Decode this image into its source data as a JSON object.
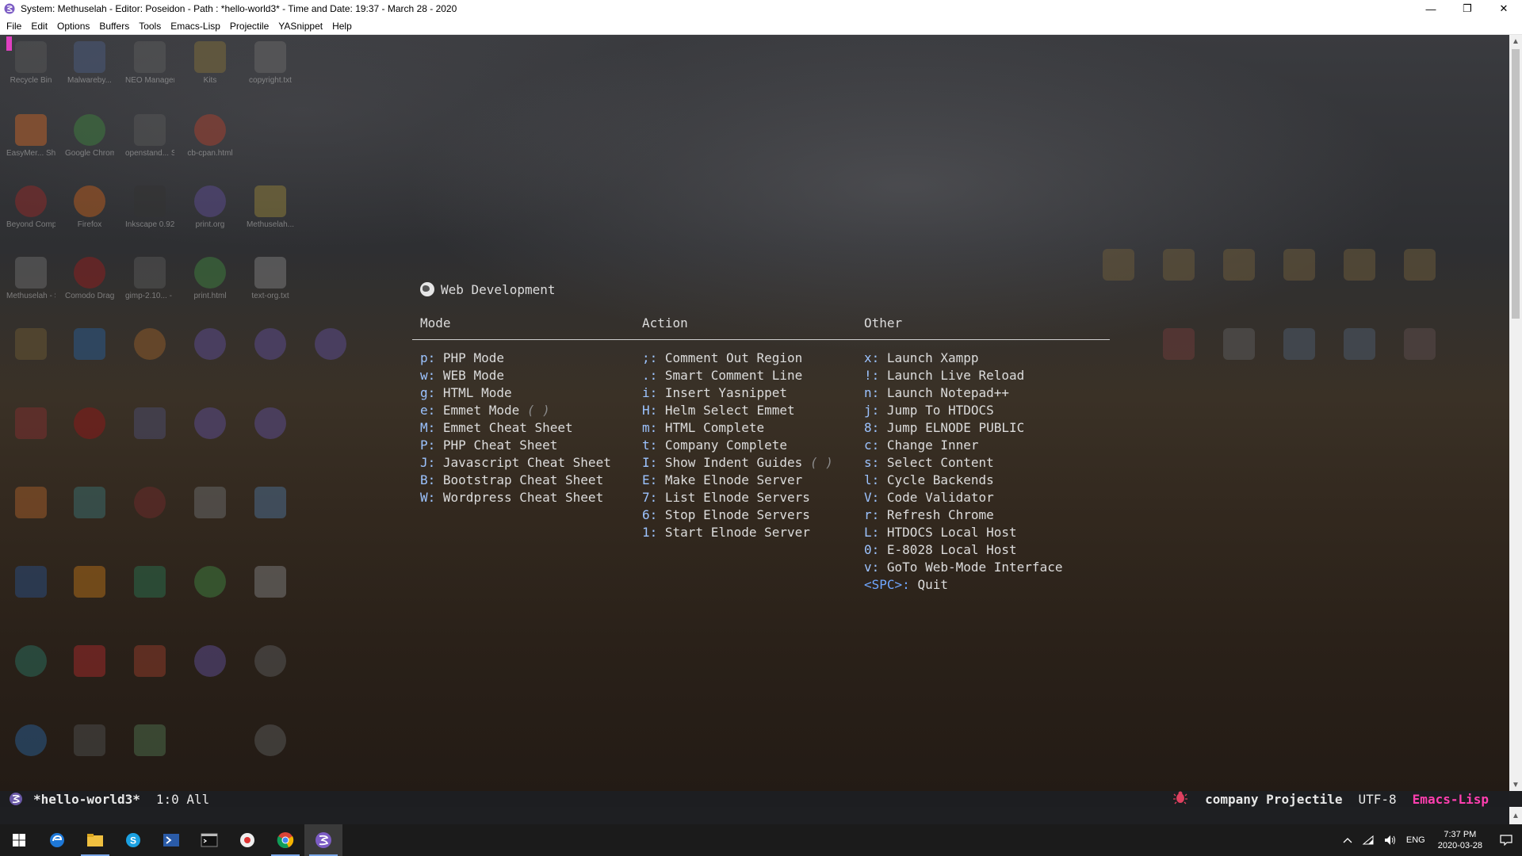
{
  "titlebar": {
    "title": "System: Methuselah - Editor: Poseidon - Path : *hello-world3* - Time and Date: 19:37 - March 28 - 2020",
    "minimize": "—",
    "restore": "❐",
    "close": "✕"
  },
  "menubar": {
    "items": [
      "File",
      "Edit",
      "Options",
      "Buffers",
      "Tools",
      "Emacs-Lisp",
      "Projectile",
      "YASnippet",
      "Help"
    ]
  },
  "desktop_icons": [
    {
      "label": "Recycle Bin"
    },
    {
      "label": "Malwareby..."
    },
    {
      "label": "NEO Manager"
    },
    {
      "label": "Kits"
    },
    {
      "label": "copyright.txt"
    },
    {
      "label": "EasyMer... Shortcut"
    },
    {
      "label": "Google Chrome"
    },
    {
      "label": "openstand... Shortcut"
    },
    {
      "label": "cb-cpan.html"
    },
    {
      "label": "Beyond Compare 4"
    },
    {
      "label": "Firefox"
    },
    {
      "label": "Inkscape 0.92.4"
    },
    {
      "label": "print.org"
    },
    {
      "label": "Methuselah..."
    },
    {
      "label": "Methuselah - Shortcut"
    },
    {
      "label": "Comodo Dragon"
    },
    {
      "label": "gimp-2.10... - Shortcut"
    },
    {
      "label": "print.html"
    },
    {
      "label": "text-org.txt"
    }
  ],
  "hydra": {
    "title": "Web Development",
    "columns": [
      {
        "header": "Mode",
        "rows": [
          {
            "key": "p:",
            "label": "PHP Mode",
            "toggle": ""
          },
          {
            "key": "w:",
            "label": "WEB Mode",
            "toggle": ""
          },
          {
            "key": "g:",
            "label": "HTML Mode",
            "toggle": ""
          },
          {
            "key": "e:",
            "label": "Emmet Mode",
            "toggle": "( )"
          },
          {
            "key": "M:",
            "label": "Emmet Cheat Sheet",
            "toggle": ""
          },
          {
            "key": "P:",
            "label": "PHP Cheat Sheet",
            "toggle": ""
          },
          {
            "key": "J:",
            "label": "Javascript Cheat Sheet",
            "toggle": ""
          },
          {
            "key": "B:",
            "label": "Bootstrap Cheat Sheet",
            "toggle": ""
          },
          {
            "key": "W:",
            "label": "Wordpress Cheat Sheet",
            "toggle": ""
          }
        ]
      },
      {
        "header": "Action",
        "rows": [
          {
            "key": ";:",
            "label": "Comment Out Region",
            "toggle": ""
          },
          {
            "key": ".:",
            "label": "Smart Comment Line",
            "toggle": ""
          },
          {
            "key": "i:",
            "label": "Insert Yasnippet",
            "toggle": ""
          },
          {
            "key": "H:",
            "label": "Helm Select Emmet",
            "toggle": ""
          },
          {
            "key": "m:",
            "label": "HTML Complete",
            "toggle": ""
          },
          {
            "key": "t:",
            "label": "Company Complete",
            "toggle": ""
          },
          {
            "key": "I:",
            "label": "Show Indent Guides",
            "toggle": "( )"
          },
          {
            "key": "E:",
            "label": "Make Elnode Server",
            "toggle": ""
          },
          {
            "key": "7:",
            "label": "List Elnode Servers",
            "toggle": ""
          },
          {
            "key": "6:",
            "label": "Stop Elnode Servers",
            "toggle": ""
          },
          {
            "key": "1:",
            "label": "Start Elnode Server",
            "toggle": ""
          }
        ]
      },
      {
        "header": "Other",
        "rows": [
          {
            "key": "x:",
            "label": "Launch Xampp",
            "toggle": ""
          },
          {
            "key": "!:",
            "label": "Launch Live Reload",
            "toggle": ""
          },
          {
            "key": "n:",
            "label": "Launch Notepad++",
            "toggle": ""
          },
          {
            "key": "j:",
            "label": "Jump To HTDOCS",
            "toggle": ""
          },
          {
            "key": "8:",
            "label": "Jump ELNODE PUBLIC",
            "toggle": ""
          },
          {
            "key": "c:",
            "label": "Change Inner",
            "toggle": ""
          },
          {
            "key": "s:",
            "label": "Select Content",
            "toggle": ""
          },
          {
            "key": "l:",
            "label": "Cycle Backends",
            "toggle": ""
          },
          {
            "key": "V:",
            "label": "Code Validator",
            "toggle": ""
          },
          {
            "key": "r:",
            "label": "Refresh Chrome",
            "toggle": ""
          },
          {
            "key": "L:",
            "label": "HTDOCS Local Host",
            "toggle": ""
          },
          {
            "key": "0:",
            "label": "E-8028 Local Host",
            "toggle": ""
          },
          {
            "key": "v:",
            "label": "GoTo Web-Mode Interface",
            "toggle": ""
          },
          {
            "key": "<SPC>:",
            "label": "Quit",
            "toggle": ""
          }
        ]
      }
    ]
  },
  "modeline": {
    "buffer": "*hello-world3*",
    "position": "1:0 All",
    "minor_modes": "company Projectile",
    "encoding": "UTF-8",
    "major_mode": "Emacs-Lisp"
  },
  "taskbar": {
    "language": "ENG",
    "time": "7:37 PM",
    "date": "2020-03-28"
  }
}
